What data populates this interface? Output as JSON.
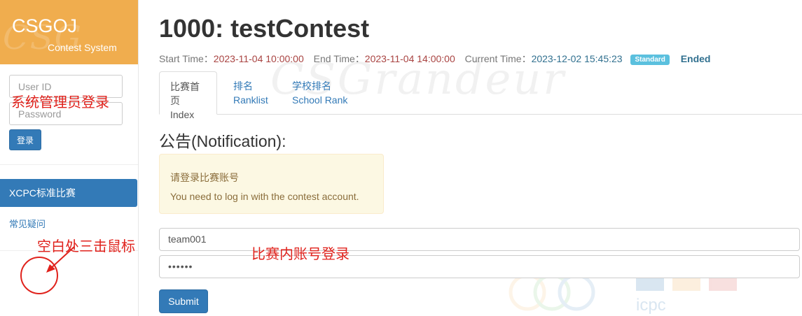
{
  "sidebar": {
    "logo_title": "CSGOJ",
    "logo_subtitle": "Contest System",
    "user_id_placeholder": "User ID",
    "password_placeholder": "Password",
    "login_button": "登录",
    "nav_active": "XCPC标准比赛",
    "faq_link": "常见疑问"
  },
  "annotations": {
    "admin_login": "系统管理员登录",
    "triple_click": "空白处三击鼠标",
    "contest_login": "比赛内账号登录"
  },
  "contest": {
    "title": "1000: testContest",
    "start_label": "Start Time：",
    "start_value": "2023-11-04 10:00:00",
    "end_label": "End Time：",
    "end_value": "2023-11-04 14:00:00",
    "current_label": "Current Time：",
    "current_value": "2023-12-02 15:45:23",
    "badge": "Standard",
    "status": "Ended"
  },
  "tabs": [
    {
      "zh": "比赛首页",
      "en": "Index"
    },
    {
      "zh": "排名",
      "en": "Ranklist"
    },
    {
      "zh": "学校排名",
      "en": "School Rank"
    }
  ],
  "notification": {
    "heading": "公告(Notification):",
    "line_zh": "请登录比赛账号",
    "line_en": "You need to log in with the contest account."
  },
  "form": {
    "team_value": "team001",
    "password_value": "••••••",
    "submit_label": "Submit"
  },
  "colors": {
    "brand_orange": "#f0ad4e",
    "primary_blue": "#337ab7",
    "annotation_red": "#e0221c"
  }
}
